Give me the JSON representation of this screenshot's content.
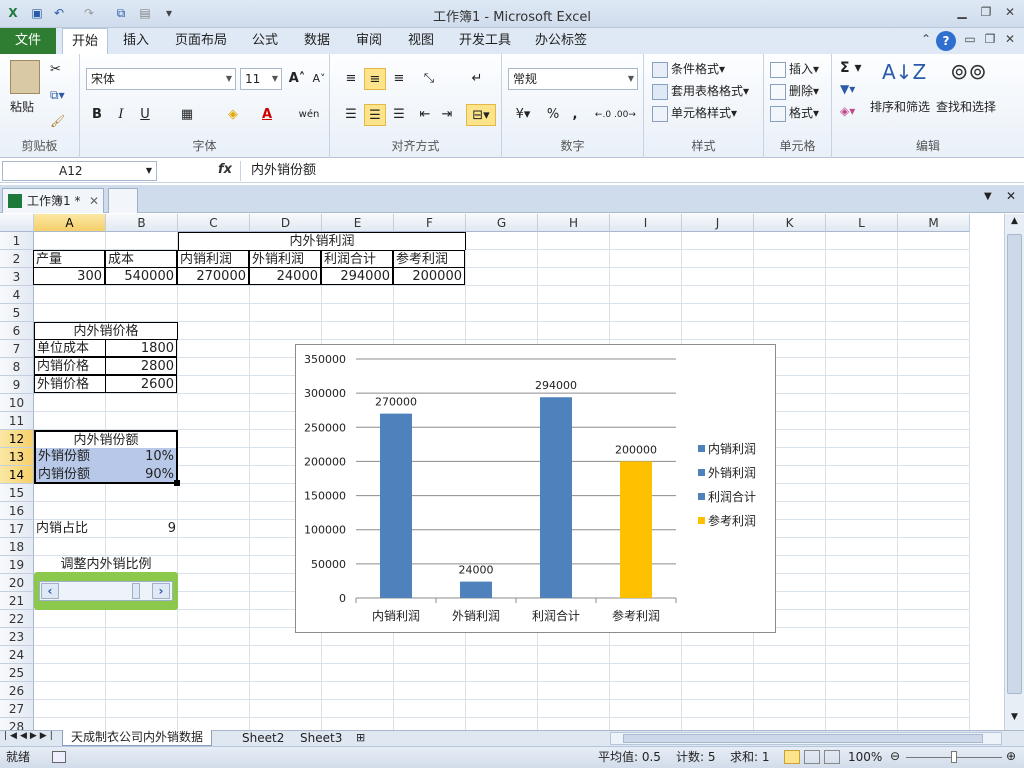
{
  "window": {
    "title": "工作簿1 - Microsoft Excel"
  },
  "ribbon_tabs": {
    "file": "文件",
    "home": "开始",
    "insert": "插入",
    "layout": "页面布局",
    "formula": "公式",
    "data": "数据",
    "review": "审阅",
    "view": "视图",
    "dev": "开发工具",
    "office": "办公标签"
  },
  "clipboard": {
    "paste": "粘贴",
    "label": "剪贴板"
  },
  "font": {
    "name": "宋体",
    "size": "11",
    "bold": "B",
    "italic": "I",
    "underline": "U",
    "label": "字体",
    "phonetic": "wén"
  },
  "align": {
    "label": "对齐方式"
  },
  "number": {
    "format": "常规",
    "label": "数字",
    "percent": "%",
    "comma": ","
  },
  "styles": {
    "cond": "条件格式",
    "table": "套用表格格式",
    "cell": "单元格样式",
    "label": "样式"
  },
  "cells": {
    "insert": "插入",
    "delete": "删除",
    "format": "格式",
    "label": "单元格"
  },
  "editing": {
    "sort": "排序和筛选",
    "find": "查找和选择",
    "label": "编辑",
    "sigma": "Σ"
  },
  "formula_bar": {
    "namebox": "A12",
    "fx": "fx",
    "content": "内外销份额"
  },
  "workbook_tab": "工作簿1 *",
  "columns": [
    "A",
    "B",
    "C",
    "D",
    "E",
    "F",
    "G",
    "H",
    "I",
    "J",
    "K",
    "L",
    "M"
  ],
  "rows": [
    "1",
    "2",
    "3",
    "4",
    "5",
    "6",
    "7",
    "8",
    "9",
    "10",
    "11",
    "12",
    "13",
    "14",
    "15",
    "16",
    "17",
    "18",
    "19",
    "20",
    "21",
    "22",
    "23",
    "24",
    "25",
    "26",
    "27",
    "28"
  ],
  "cells_data": {
    "c1": "内外销利润",
    "r2": [
      "产量",
      "成本",
      "内销利润",
      "外销利润",
      "利润合计",
      "参考利润"
    ],
    "r3": [
      "300",
      "540000",
      "270000",
      "24000",
      "294000",
      "200000"
    ],
    "price_title": "内外销价格",
    "r7": [
      "单位成本",
      "1800"
    ],
    "r8": [
      "内销价格",
      "2800"
    ],
    "r9": [
      "外销价格",
      "2600"
    ],
    "share_title": "内外销份额",
    "r13": [
      "外销份额",
      "10%"
    ],
    "r14": [
      "内销份额",
      "90%"
    ],
    "r17": [
      "内销占比",
      "9"
    ],
    "r19": "调整内外销比例"
  },
  "sheet_tabs": [
    "天成制衣公司内外销数据",
    "Sheet2",
    "Sheet3"
  ],
  "status": {
    "ready": "就绪",
    "avg": "平均值: 0.5",
    "count": "计数: 5",
    "sum": "求和: 1",
    "zoom": "100%"
  },
  "chart_data": {
    "type": "bar",
    "categories": [
      "内销利润",
      "外销利润",
      "利润合计",
      "参考利润"
    ],
    "values": [
      270000,
      24000,
      294000,
      200000
    ],
    "colors": [
      "#4f81bd",
      "#4f81bd",
      "#4f81bd",
      "#ffc000"
    ],
    "ylim": [
      0,
      350000
    ],
    "yticks": [
      "0",
      "50000",
      "100000",
      "150000",
      "200000",
      "250000",
      "300000",
      "350000"
    ],
    "data_labels": [
      "270000",
      "24000",
      "294000",
      "200000"
    ],
    "legend": [
      {
        "name": "内销利润",
        "color": "#4f81bd"
      },
      {
        "name": "外销利润",
        "color": "#4f81bd"
      },
      {
        "name": "利润合计",
        "color": "#4f81bd"
      },
      {
        "name": "参考利润",
        "color": "#ffc000"
      }
    ],
    "legend_position": "right",
    "grid": true
  }
}
